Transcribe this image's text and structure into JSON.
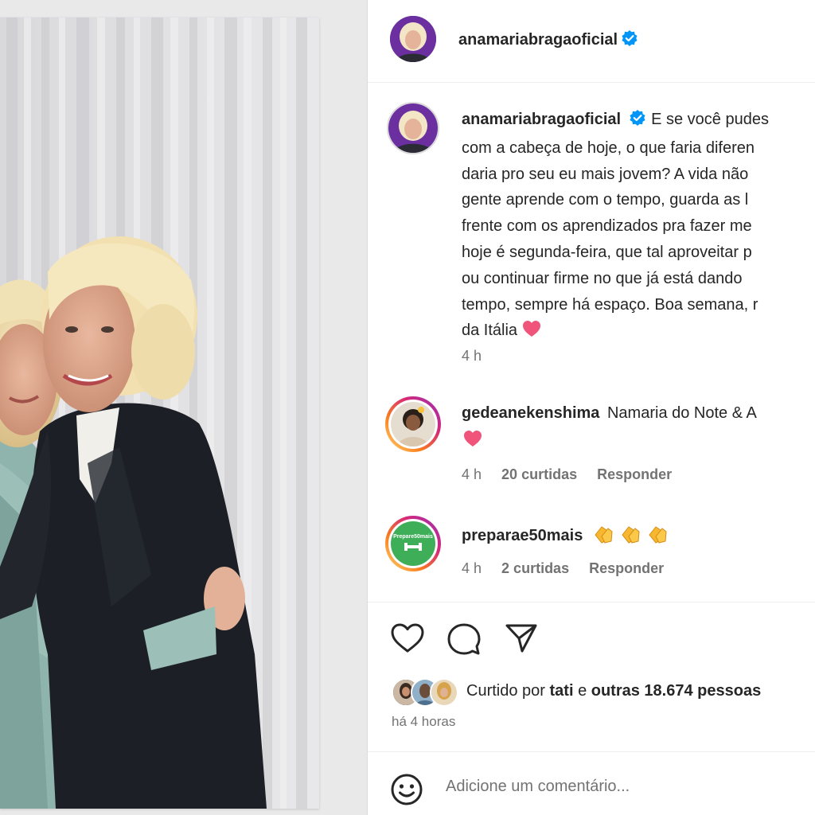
{
  "post": {
    "author": "anamariabragaoficial",
    "caption_lines": [
      "E se você pudes",
      "com a cabeça de hoje, o que faria diferen",
      "daria pro seu eu mais jovem? A vida não",
      "gente aprende com o tempo, guarda as l",
      "frente com os aprendizados pra fazer me",
      "hoje é segunda-feira, que tal aproveitar p",
      "ou continuar firme no que já está dando",
      "tempo, sempre há espaço. Boa semana, r",
      "da Itália"
    ],
    "caption_time": "4 h"
  },
  "comments": [
    {
      "username": "gedeanekenshima",
      "text": "Namaria do Note & A",
      "time": "4 h",
      "likes": "20 curtidas",
      "reply": "Responder"
    },
    {
      "username": "preparae50mais",
      "avatar_text": "Prepare50mais",
      "time": "4 h",
      "likes": "2 curtidas",
      "reply": "Responder"
    }
  ],
  "likes": {
    "prefix": "Curtido por",
    "first_user": "tati",
    "connector": "e",
    "others": "outras 18.674 pessoas"
  },
  "timestamp": "há 4 horas",
  "comment_input": {
    "placeholder": "Adicione um comentário..."
  },
  "icons": {
    "like": "heart-outline-icon",
    "comment": "speech-bubble-icon",
    "share": "paper-plane-icon",
    "emoji": "smiley-icon",
    "verified": "verified-badge-icon"
  },
  "colors": {
    "verified": "#0095f6",
    "heart_emoji": "#f0547a",
    "story_ring": "#d6249f",
    "muted": "#737373"
  }
}
